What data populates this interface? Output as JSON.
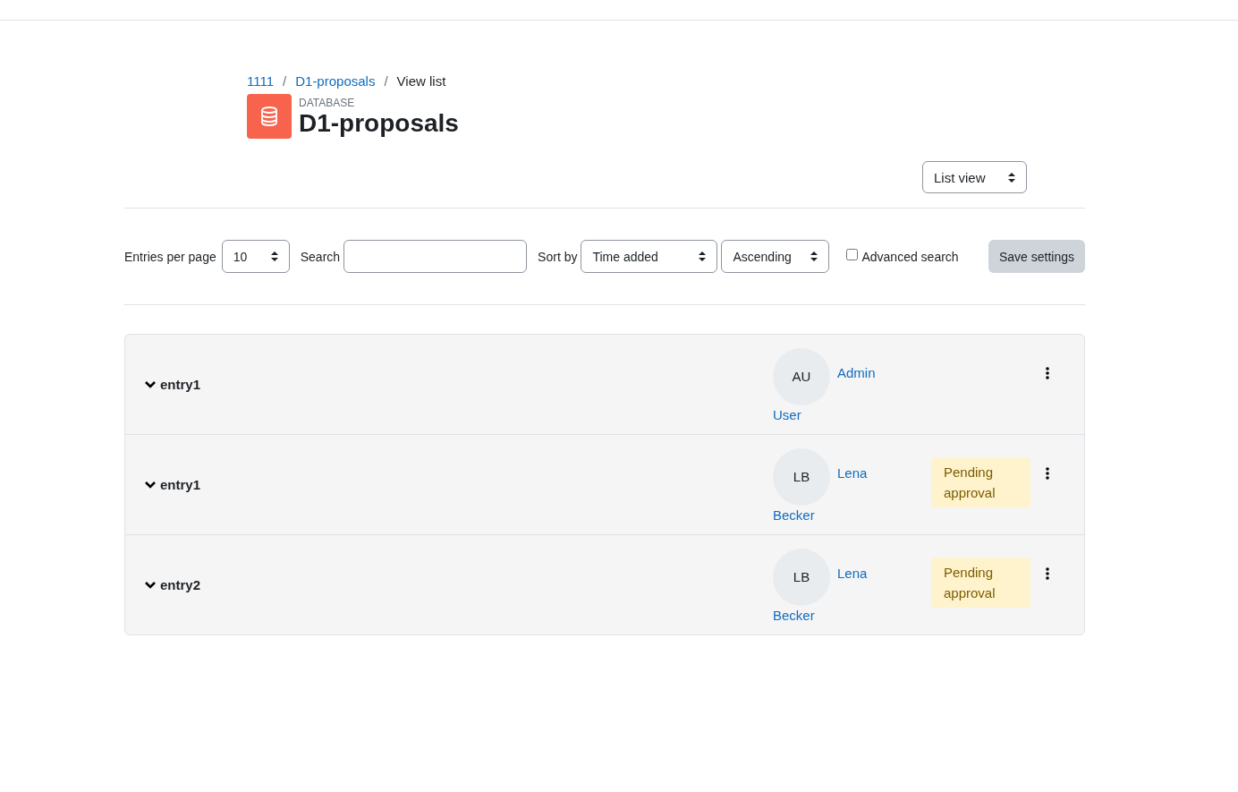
{
  "breadcrumb": [
    {
      "label": "1111",
      "link": true
    },
    {
      "label": "D1-proposals",
      "link": true
    },
    {
      "label": "View list",
      "link": false
    }
  ],
  "breadcrumb_separator": "/",
  "header": {
    "kicker": "DATABASE",
    "title": "D1-proposals"
  },
  "view_select": {
    "value": "List view"
  },
  "controls": {
    "entries_label": "Entries per page",
    "entries_value": "10",
    "search_label": "Search",
    "sort_label": "Sort by",
    "sort_value": "Time added",
    "order_value": "Ascending",
    "advanced_label": "Advanced search",
    "advanced_checked": false,
    "save_button": "Save settings"
  },
  "entries": [
    {
      "name": "entry1",
      "expanded": true,
      "initials": "AU",
      "user_first": "Admin",
      "user_last": "User"
    },
    {
      "name": "entry1",
      "expanded": true,
      "initials": "LB",
      "user_first": "Lena",
      "user_last": "Becker",
      "status": "Pending approval"
    },
    {
      "name": "entry2",
      "expanded": true,
      "initials": "LB",
      "user_first": "Lena",
      "user_last": "Becker",
      "status": "Pending approval"
    }
  ]
}
